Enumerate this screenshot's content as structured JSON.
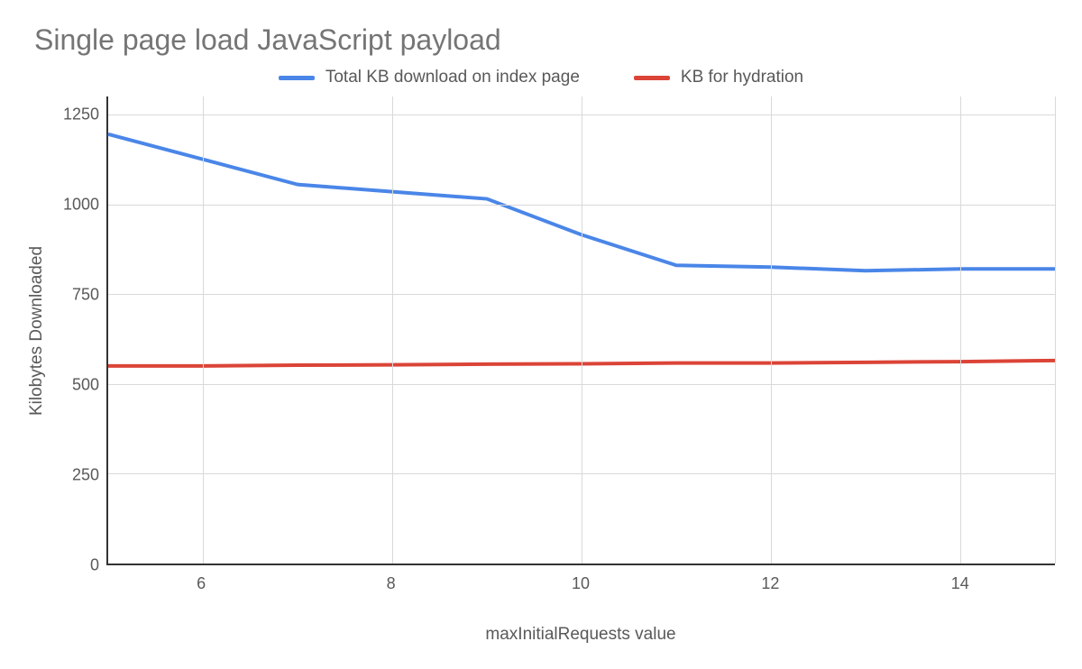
{
  "chart_data": {
    "type": "line",
    "title": "Single page load JavaScript payload",
    "xlabel": "maxInitialRequests value",
    "ylabel": "Kilobytes Downloaded",
    "x": [
      5,
      6,
      7,
      8,
      9,
      10,
      11,
      12,
      13,
      14,
      15
    ],
    "x_ticks": [
      6,
      8,
      10,
      12,
      14
    ],
    "y_ticks": [
      0,
      250,
      500,
      750,
      1000,
      1250
    ],
    "xlim": [
      5,
      15
    ],
    "ylim": [
      0,
      1300
    ],
    "series": [
      {
        "name": "Total KB download on index page",
        "color": "#4a86e8",
        "values": [
          1195,
          1125,
          1055,
          1035,
          1015,
          915,
          830,
          825,
          815,
          820,
          820
        ]
      },
      {
        "name": "KB for hydration",
        "color": "#db4437",
        "values": [
          550,
          550,
          552,
          553,
          555,
          556,
          558,
          558,
          560,
          562,
          565
        ]
      }
    ],
    "legend_position": "top"
  }
}
